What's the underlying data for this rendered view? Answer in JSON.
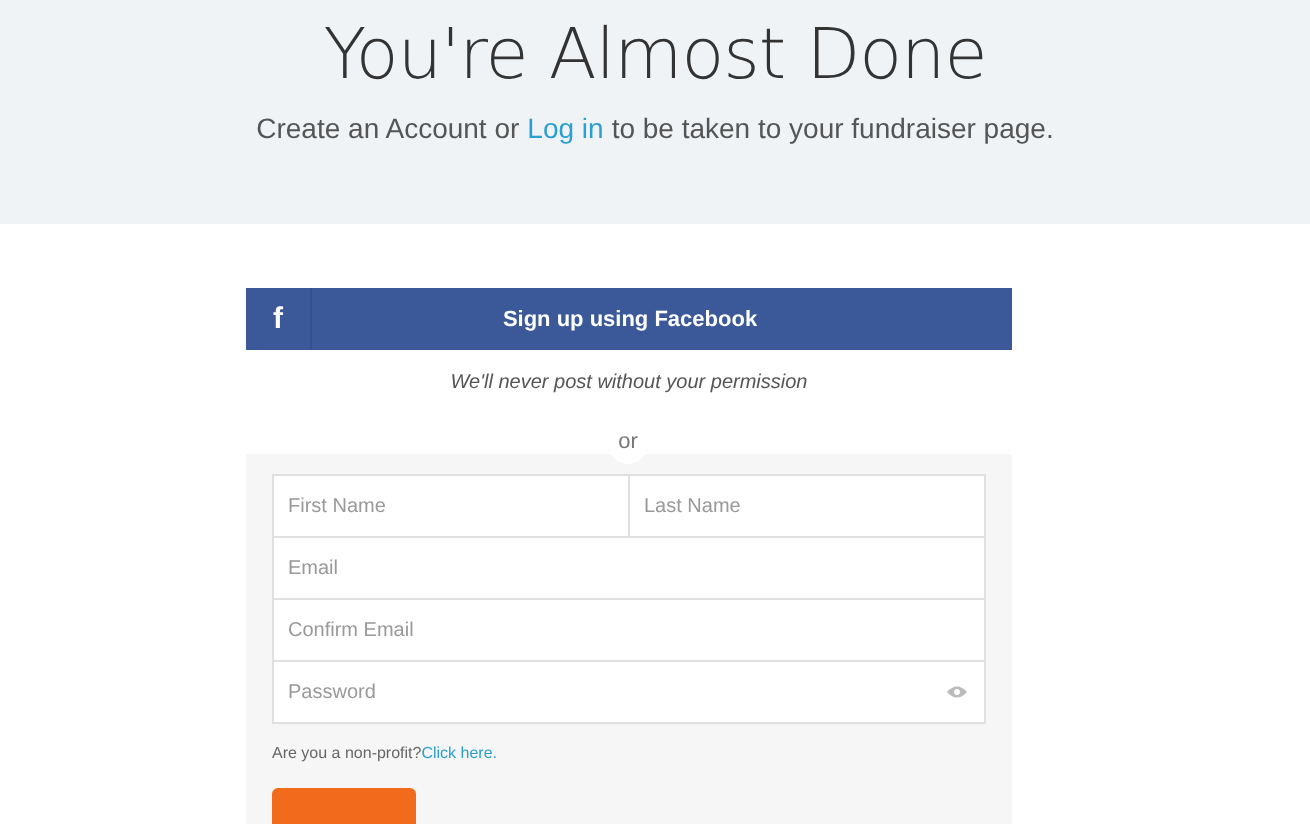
{
  "header": {
    "title": "You're Almost Done",
    "subtitle_before": "Create an Account or",
    "subtitle_link": "Log in",
    "subtitle_after": "to be taken to your fundraiser page."
  },
  "facebook_button": {
    "icon": "f",
    "label": "Sign up using Facebook"
  },
  "facebook_note": "We'll never post without your permission",
  "divider": "or",
  "fields": [
    {
      "placeholder": "First Name",
      "kind": "half"
    },
    {
      "placeholder": "Last Name",
      "kind": "half"
    },
    {
      "placeholder": "Email",
      "kind": "full"
    },
    {
      "placeholder": "Confirm Email",
      "kind": "full"
    },
    {
      "placeholder": "Password",
      "kind": "password"
    }
  ],
  "nonprofit": {
    "question": "Are you a non-profit?",
    "link": "Click here."
  }
}
